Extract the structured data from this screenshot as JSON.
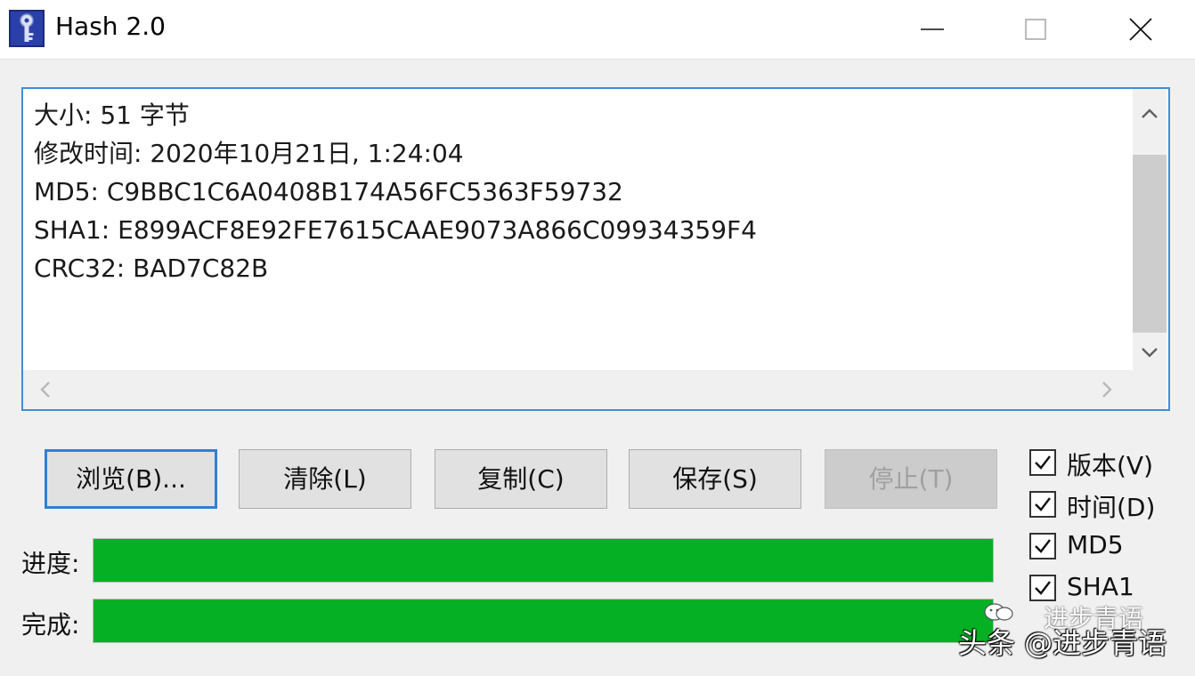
{
  "window": {
    "title": "Hash 2.0",
    "icon": "key-icon"
  },
  "output": {
    "lines": [
      "大小: 51 字节",
      "修改时间: 2020年10月21日, 1:24:04",
      "MD5: C9BBC1C6A0408B174A56FC5363F59732",
      "SHA1: E899ACF8E92FE7615CAAE9073A866C09934359F4",
      "CRC32: BAD7C82B"
    ]
  },
  "buttons": {
    "browse": "浏览(B)...",
    "clear": "清除(L)",
    "copy": "复制(C)",
    "save": "保存(S)",
    "stop": "停止(T)"
  },
  "options": {
    "version": "版本(V)",
    "time": "时间(D)",
    "md5": "MD5",
    "sha1": "SHA1"
  },
  "progress": {
    "label": "进度:",
    "value": 1.0
  },
  "complete": {
    "label": "完成:",
    "value": 1.0
  },
  "colors": {
    "progress_fill": "#06b025",
    "focus_border": "#3d8fd6"
  },
  "watermark": {
    "text": "头条 @进步青语",
    "top_text": "进步青语"
  }
}
